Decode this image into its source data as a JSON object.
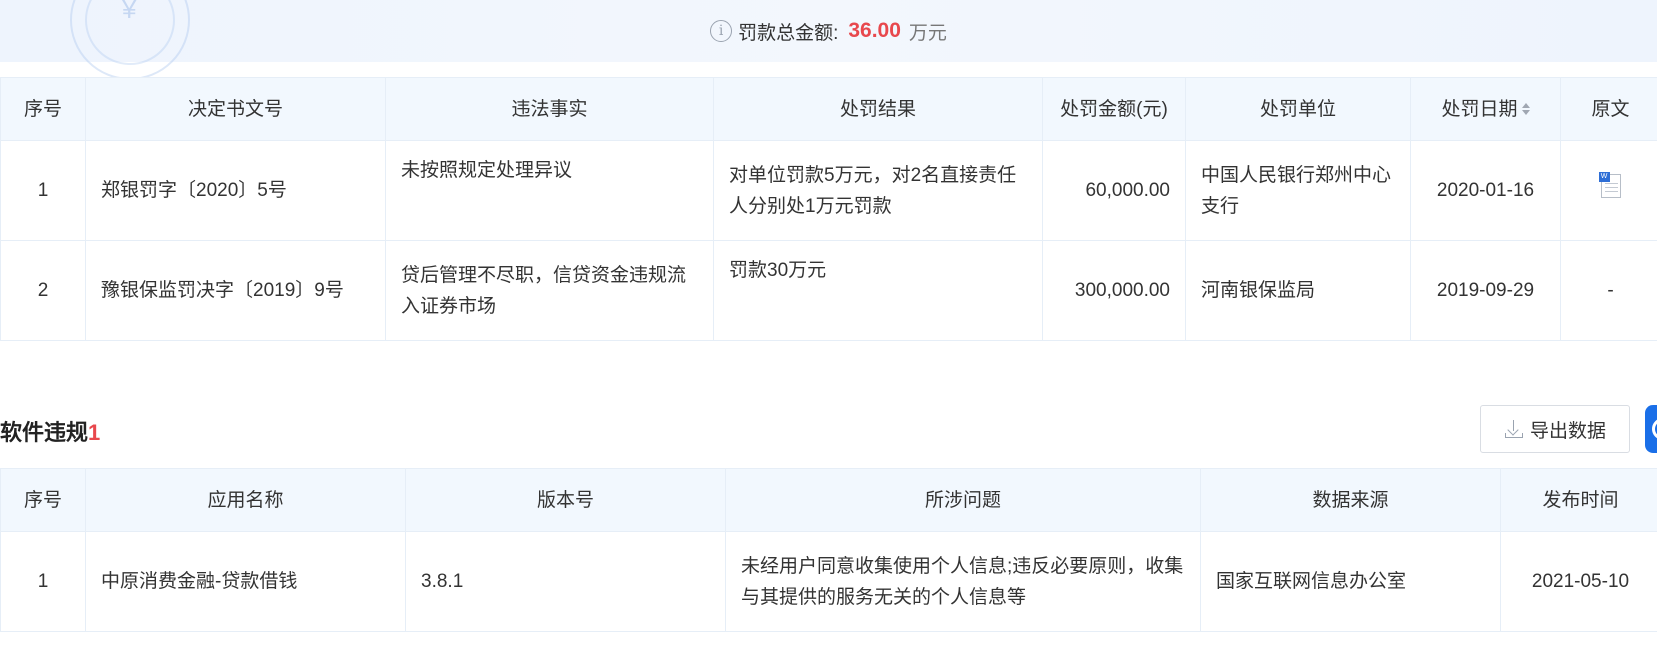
{
  "summary": {
    "label": "罚款总金额:",
    "amount": "36.00",
    "unit": "万元",
    "info_icon": "info-icon"
  },
  "penalty_table": {
    "headers": [
      "序号",
      "决定书文号",
      "违法事实",
      "处罚结果",
      "处罚金额(元)",
      "处罚单位",
      "处罚日期",
      "原文"
    ],
    "rows": [
      {
        "index": "1",
        "doc_no": "郑银罚字〔2020〕5号",
        "fact": "未按照规定处理异议",
        "result": "对单位罚款5万元，对2名直接责任人分别处1万元罚款",
        "amount": "60,000.00",
        "unit": "中国人民银行郑州中心支行",
        "date": "2020-01-16",
        "original": "",
        "original_icon": "word-document-icon"
      },
      {
        "index": "2",
        "doc_no": "豫银保监罚决字〔2019〕9号",
        "fact": "贷后管理不尽职，信贷资金违规流入证券市场",
        "result": "罚款30万元",
        "amount": "300,000.00",
        "unit": "河南银保监局",
        "date": "2019-09-29",
        "original": "-"
      }
    ]
  },
  "software_section": {
    "title": "软件违规",
    "count": "1",
    "export_label": "导出数据",
    "export_icon": "download-icon",
    "accent_color": "#1a6fe8"
  },
  "software_table": {
    "headers": [
      "序号",
      "应用名称",
      "版本号",
      "所涉问题",
      "数据来源",
      "发布时间"
    ],
    "rows": [
      {
        "index": "1",
        "app": "中原消费金融-贷款借钱",
        "version": "3.8.1",
        "issue": "未经用户同意收集使用个人信息;违反必要原则，收集与其提供的服务无关的个人信息等",
        "source": "国家互联网信息办公室",
        "date": "2021-05-10"
      }
    ]
  },
  "colors": {
    "accent_red": "#e8484d",
    "header_bg": "#f2f8fe",
    "border": "#e6eef7"
  }
}
